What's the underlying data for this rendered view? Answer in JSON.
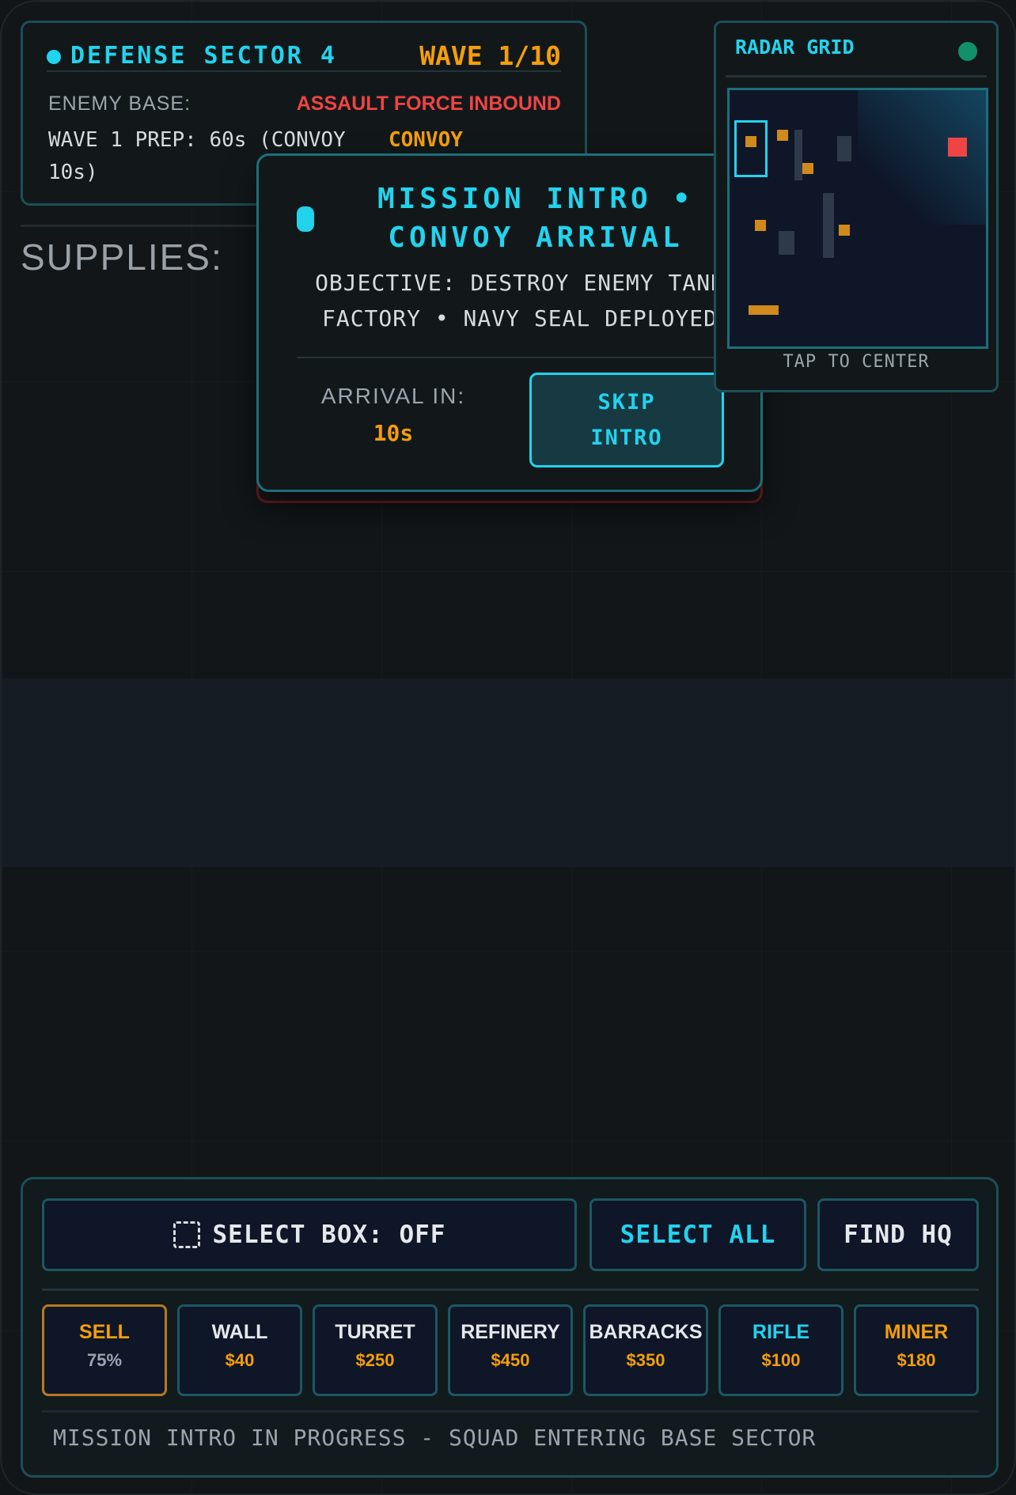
{
  "status": {
    "sector": "DEFENSE SECTOR 4",
    "wave": "WAVE 1/10",
    "enemy_label": "ENEMY BASE:",
    "enemy_status": "ASSAULT FORCE INBOUND",
    "prep": "WAVE 1 PREP: 60s (CONVOY 10s)",
    "convoy": "CONVOY"
  },
  "supplies_label": "SUPPLIES:",
  "modal": {
    "title": "MISSION INTRO • CONVOY ARRIVAL",
    "objective": "OBJECTIVE: DESTROY ENEMY TANK FACTORY • NAVY SEAL DEPLOYED",
    "arrival_label": "ARRIVAL IN:",
    "arrival_value": "10s",
    "skip_line1": "SKIP",
    "skip_line2": "INTRO"
  },
  "radar": {
    "title": "RADAR GRID",
    "footer": "TAP TO CENTER",
    "status_color": "#10916a",
    "marker_colors": {
      "friendly": "#d08a1c",
      "enemy": "#ef4444",
      "structure": "#2e3a4a",
      "viewport": "#22d3ee"
    }
  },
  "controls": {
    "select_box": "SELECT BOX: OFF",
    "select_all": "SELECT ALL",
    "find_hq": "FIND HQ",
    "tools": [
      {
        "name": "SELL",
        "price": "75%"
      },
      {
        "name": "WALL",
        "price": "$40"
      },
      {
        "name": "TURRET",
        "price": "$250"
      },
      {
        "name": "REFINERY",
        "price": "$450"
      },
      {
        "name": "BARRACKS",
        "price": "$350"
      },
      {
        "name": "RIFLE",
        "price": "$100"
      },
      {
        "name": "MINER",
        "price": "$180"
      }
    ],
    "message": "MISSION INTRO IN PROGRESS - SQUAD ENTERING BASE SECTOR"
  },
  "colors": {
    "accent": "#22d3ee",
    "warning": "#f59e0b",
    "danger": "#ef4444"
  }
}
